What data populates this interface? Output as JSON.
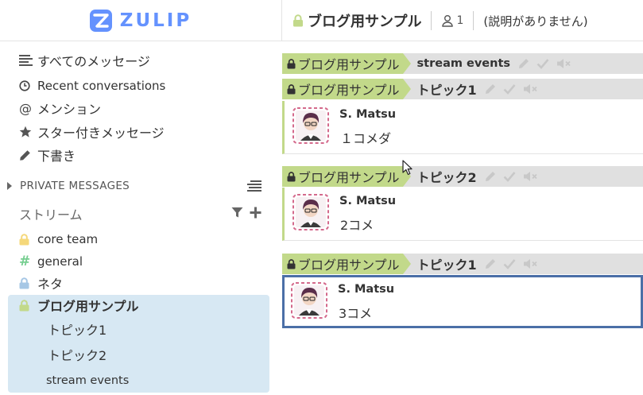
{
  "brand": {
    "name": "ZULIP",
    "logo_icon": "zulip-logo-icon"
  },
  "header": {
    "stream_name": "ブログ用サンプル",
    "subscriber_count": "1",
    "description": "(説明がありません)"
  },
  "sidebar": {
    "nav": [
      {
        "label": "すべてのメッセージ",
        "icon": "all-messages-icon"
      },
      {
        "label": "Recent conversations",
        "icon": "clock-icon"
      },
      {
        "label": "メンション",
        "icon": "at-icon"
      },
      {
        "label": "スター付きメッセージ",
        "icon": "star-icon"
      },
      {
        "label": "下書き",
        "icon": "pencil-icon"
      }
    ],
    "private_messages_label": "PRIVATE MESSAGES",
    "streams_label": "ストリーム",
    "streams": [
      {
        "name": "core team",
        "icon": "lock-icon",
        "color": "#f5d87a"
      },
      {
        "name": "general",
        "icon": "hash-icon",
        "color": "#76ce90"
      },
      {
        "name": "ネタ",
        "icon": "lock-icon",
        "color": "#a6c7e5"
      },
      {
        "name": "ブログ用サンプル",
        "icon": "lock-icon",
        "color": "#c2d98a"
      }
    ],
    "topics": [
      "トピック1",
      "トピック2",
      "stream events"
    ]
  },
  "feed": {
    "recipient_blocks": [
      {
        "stream": "ブログ用サンプル",
        "topic": "stream events",
        "messages": []
      },
      {
        "stream": "ブログ用サンプル",
        "topic": "トピック1",
        "messages": [
          {
            "sender": "S. Matsu",
            "content": "１コメダ"
          }
        ]
      },
      {
        "stream": "ブログ用サンプル",
        "topic": "トピック2",
        "messages": [
          {
            "sender": "S. Matsu",
            "content": "2コメ"
          }
        ]
      },
      {
        "stream": "ブログ用サンプル",
        "topic": "トピック1",
        "messages": [
          {
            "sender": "S. Matsu",
            "content": "3コメ"
          }
        ]
      }
    ]
  },
  "colors": {
    "accent": "#6492fe",
    "stream_color": "#c2d98a",
    "selected_border": "#4b6fa7",
    "active_bg": "#d7e8f3"
  }
}
